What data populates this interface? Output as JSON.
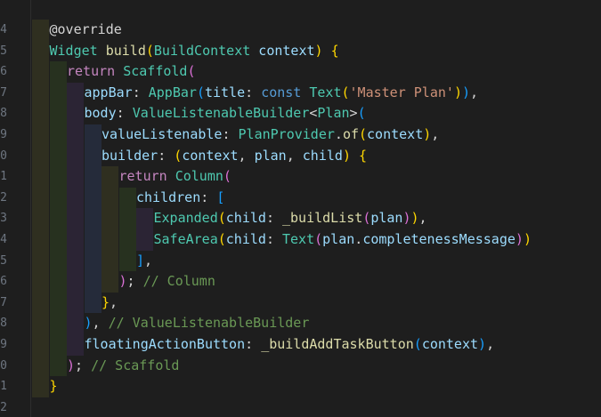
{
  "editor": {
    "theme": {
      "background": "#1e1e1e",
      "indent_guide_colors": [
        "#2f2f20",
        "#27311f",
        "#2b2434",
        "#252b3a"
      ]
    },
    "line_numbers": [
      "4",
      "5",
      "6",
      "7",
      "8",
      "9",
      "0",
      "1",
      "2",
      "3",
      "4",
      "5",
      "6",
      "7",
      "8",
      "9",
      "0",
      "1",
      "2"
    ],
    "lines": [
      {
        "indent": 1,
        "tokens": [
          {
            "t": "@override",
            "c": "an"
          }
        ]
      },
      {
        "indent": 1,
        "tokens": [
          {
            "t": "Widget",
            "c": "type"
          },
          {
            "t": " ",
            "c": "pun"
          },
          {
            "t": "build",
            "c": "fn"
          },
          {
            "t": "(",
            "c": "b1"
          },
          {
            "t": "BuildContext",
            "c": "type"
          },
          {
            "t": " context",
            "c": "prop"
          },
          {
            "t": ")",
            "c": "b1"
          },
          {
            "t": " ",
            "c": "pun"
          },
          {
            "t": "{",
            "c": "b1"
          }
        ]
      },
      {
        "indent": 2,
        "tokens": [
          {
            "t": "return",
            "c": "ctl"
          },
          {
            "t": " ",
            "c": "pun"
          },
          {
            "t": "Scaffold",
            "c": "type"
          },
          {
            "t": "(",
            "c": "b2"
          }
        ]
      },
      {
        "indent": 3,
        "tokens": [
          {
            "t": "appBar",
            "c": "prop"
          },
          {
            "t": ": ",
            "c": "pun"
          },
          {
            "t": "AppBar",
            "c": "type"
          },
          {
            "t": "(",
            "c": "b3"
          },
          {
            "t": "title",
            "c": "prop"
          },
          {
            "t": ": ",
            "c": "pun"
          },
          {
            "t": "const",
            "c": "kw"
          },
          {
            "t": " ",
            "c": "pun"
          },
          {
            "t": "Text",
            "c": "type"
          },
          {
            "t": "(",
            "c": "b1"
          },
          {
            "t": "'Master Plan'",
            "c": "str"
          },
          {
            "t": ")",
            "c": "b1"
          },
          {
            "t": ")",
            "c": "b3"
          },
          {
            "t": ",",
            "c": "pun"
          }
        ]
      },
      {
        "indent": 3,
        "tokens": [
          {
            "t": "body",
            "c": "prop"
          },
          {
            "t": ": ",
            "c": "pun"
          },
          {
            "t": "ValueListenableBuilder",
            "c": "type"
          },
          {
            "t": "<",
            "c": "pun"
          },
          {
            "t": "Plan",
            "c": "type"
          },
          {
            "t": ">",
            "c": "pun"
          },
          {
            "t": "(",
            "c": "b3"
          }
        ]
      },
      {
        "indent": 4,
        "tokens": [
          {
            "t": "valueListenable",
            "c": "prop"
          },
          {
            "t": ": ",
            "c": "pun"
          },
          {
            "t": "PlanProvider",
            "c": "type"
          },
          {
            "t": ".",
            "c": "pun"
          },
          {
            "t": "of",
            "c": "fn"
          },
          {
            "t": "(",
            "c": "b1"
          },
          {
            "t": "context",
            "c": "prop"
          },
          {
            "t": ")",
            "c": "b1"
          },
          {
            "t": ",",
            "c": "pun"
          }
        ]
      },
      {
        "indent": 4,
        "tokens": [
          {
            "t": "builder",
            "c": "prop"
          },
          {
            "t": ": ",
            "c": "pun"
          },
          {
            "t": "(",
            "c": "b1"
          },
          {
            "t": "context",
            "c": "prop"
          },
          {
            "t": ", ",
            "c": "pun"
          },
          {
            "t": "plan",
            "c": "prop"
          },
          {
            "t": ", ",
            "c": "pun"
          },
          {
            "t": "child",
            "c": "prop"
          },
          {
            "t": ")",
            "c": "b1"
          },
          {
            "t": " ",
            "c": "pun"
          },
          {
            "t": "{",
            "c": "b1"
          }
        ]
      },
      {
        "indent": 5,
        "tokens": [
          {
            "t": "return",
            "c": "ctl"
          },
          {
            "t": " ",
            "c": "pun"
          },
          {
            "t": "Column",
            "c": "type"
          },
          {
            "t": "(",
            "c": "b2"
          }
        ]
      },
      {
        "indent": 6,
        "tokens": [
          {
            "t": "children",
            "c": "prop"
          },
          {
            "t": ": ",
            "c": "pun"
          },
          {
            "t": "[",
            "c": "b3"
          }
        ]
      },
      {
        "indent": 7,
        "tokens": [
          {
            "t": "Expanded",
            "c": "type"
          },
          {
            "t": "(",
            "c": "b1"
          },
          {
            "t": "child",
            "c": "prop"
          },
          {
            "t": ": ",
            "c": "pun"
          },
          {
            "t": "_buildList",
            "c": "fn"
          },
          {
            "t": "(",
            "c": "b2"
          },
          {
            "t": "plan",
            "c": "prop"
          },
          {
            "t": ")",
            "c": "b2"
          },
          {
            "t": ")",
            "c": "b1"
          },
          {
            "t": ",",
            "c": "pun"
          }
        ]
      },
      {
        "indent": 7,
        "tokens": [
          {
            "t": "SafeArea",
            "c": "type"
          },
          {
            "t": "(",
            "c": "b1"
          },
          {
            "t": "child",
            "c": "prop"
          },
          {
            "t": ": ",
            "c": "pun"
          },
          {
            "t": "Text",
            "c": "type"
          },
          {
            "t": "(",
            "c": "b2"
          },
          {
            "t": "plan",
            "c": "prop"
          },
          {
            "t": ".",
            "c": "pun"
          },
          {
            "t": "completenessMessage",
            "c": "prop"
          },
          {
            "t": ")",
            "c": "b2"
          },
          {
            "t": ")",
            "c": "b1"
          }
        ]
      },
      {
        "indent": 6,
        "tokens": [
          {
            "t": "]",
            "c": "b3"
          },
          {
            "t": ",",
            "c": "pun"
          }
        ]
      },
      {
        "indent": 5,
        "tokens": [
          {
            "t": ")",
            "c": "b2"
          },
          {
            "t": "; ",
            "c": "pun"
          },
          {
            "t": "// Column",
            "c": "com"
          }
        ]
      },
      {
        "indent": 4,
        "tokens": [
          {
            "t": "}",
            "c": "b1"
          },
          {
            "t": ",",
            "c": "pun"
          }
        ]
      },
      {
        "indent": 3,
        "tokens": [
          {
            "t": ")",
            "c": "b3"
          },
          {
            "t": ", ",
            "c": "pun"
          },
          {
            "t": "// ValueListenableBuilder",
            "c": "com"
          }
        ]
      },
      {
        "indent": 3,
        "tokens": [
          {
            "t": "floatingActionButton",
            "c": "prop"
          },
          {
            "t": ": ",
            "c": "pun"
          },
          {
            "t": "_buildAddTaskButton",
            "c": "fn"
          },
          {
            "t": "(",
            "c": "b3"
          },
          {
            "t": "context",
            "c": "prop"
          },
          {
            "t": ")",
            "c": "b3"
          },
          {
            "t": ",",
            "c": "pun"
          }
        ]
      },
      {
        "indent": 2,
        "tokens": [
          {
            "t": ")",
            "c": "b2"
          },
          {
            "t": "; ",
            "c": "pun"
          },
          {
            "t": "// Scaffold",
            "c": "com"
          }
        ]
      },
      {
        "indent": 1,
        "tokens": [
          {
            "t": "}",
            "c": "b1"
          }
        ]
      },
      {
        "indent": 0,
        "tokens": []
      }
    ]
  }
}
